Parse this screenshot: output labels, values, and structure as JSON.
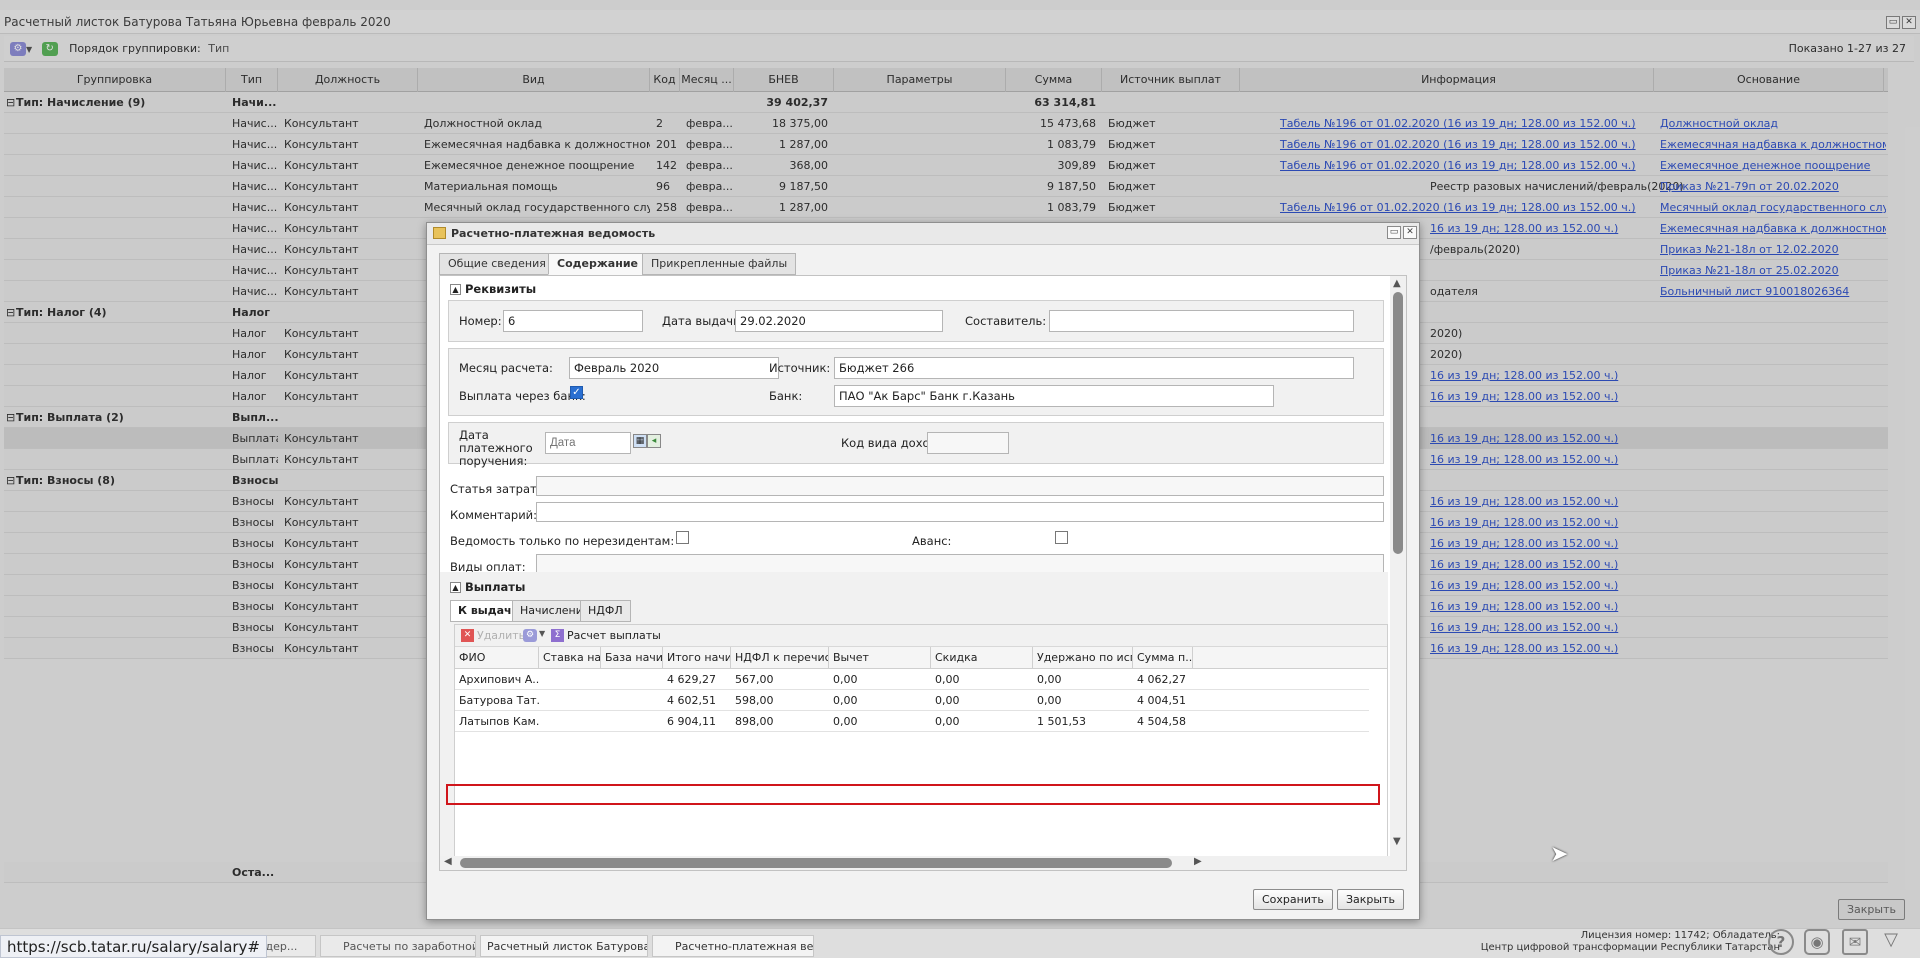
{
  "main": {
    "title": "Расчетный листок Батурова Татьяна Юрьевна февраль 2020",
    "toolbar": {
      "group_order_label": "Порядок группировки:",
      "group_order_value": "Тип",
      "shown": "Показано 1-27 из 27"
    },
    "columns": [
      "Группировка",
      "Тип",
      "Должность",
      "Вид",
      "Код",
      "Месяц ...",
      "БНЕВ",
      "Параметры",
      "Сумма",
      "Источник выплат",
      "Информация",
      "Основание"
    ],
    "rows": [
      {
        "group": "Тип: Начисление (9)",
        "type": "Начи...",
        "bnev": "39 402,37",
        "sum": "63 314,81"
      },
      {
        "type": "Начис...",
        "pos": "Консультант",
        "kind": "Должностной оклад",
        "code": "2",
        "month": "февра...",
        "bnev": "18 375,00",
        "sum": "15 473,68",
        "src": "Бюджет",
        "info": "Табель №196 от 01.02.2020 (16 из 19 дн; 128.00 из 152.00 ч.)",
        "basis": "Должностной оклад"
      },
      {
        "type": "Начис...",
        "pos": "Консультант",
        "kind": "Ежемесячная надбавка к должностному ...",
        "code": "201",
        "month": "февра...",
        "bnev": "1 287,00",
        "sum": "1 083,79",
        "src": "Бюджет",
        "info": "Табель №196 от 01.02.2020 (16 из 19 дн; 128.00 из 152.00 ч.)",
        "basis": "Ежемесячная надбавка к должностному о..."
      },
      {
        "type": "Начис...",
        "pos": "Консультант",
        "kind": "Ежемесячное денежное поощрение",
        "code": "142",
        "month": "февра...",
        "bnev": "368,00",
        "sum": "309,89",
        "src": "Бюджет",
        "info": "Табель №196 от 01.02.2020 (16 из 19 дн; 128.00 из 152.00 ч.)",
        "basis": "Ежемесячное денежное поощрение"
      },
      {
        "type": "Начис...",
        "pos": "Консультант",
        "kind": "Материальная помощь",
        "code": "96",
        "month": "февра...",
        "bnev": "9 187,50",
        "sum": "9 187,50",
        "src": "Бюджет",
        "info_plain": "Реестр разовых начислений/февраль(2020)",
        "basis": "Приказ №21-79п от 20.02.2020"
      },
      {
        "type": "Начис...",
        "pos": "Консультант",
        "kind": "Месячный оклад государственного служ...",
        "code": "258",
        "month": "февра...",
        "bnev": "1 287,00",
        "sum": "1 083,79",
        "src": "Бюджет",
        "info": "Табель №196 от 01.02.2020 (16 из 19 дн; 128.00 из 152.00 ч.)",
        "basis": "Месячный оклад государственного служа..."
      },
      {
        "type": "Начис...",
        "pos": "Консультант",
        "info": "16 из 19 дн; 128.00 из 152.00 ч.)",
        "basis": "Ежемесячная надбавка к должностному о..."
      },
      {
        "type": "Начис...",
        "pos": "Консультант",
        "info_plain": "/февраль(2020)",
        "basis": "Приказ №21-18л от 12.02.2020"
      },
      {
        "type": "Начис...",
        "pos": "Консультант",
        "basis": "Приказ №21-18л от 25.02.2020"
      },
      {
        "type": "Начис...",
        "pos": "Консультант",
        "info_plain": "одателя",
        "basis": "Больничный лист 910018026364"
      },
      {
        "group": "Тип: Налог (4)",
        "type": "Налог"
      },
      {
        "type": "Налог",
        "pos": "Консультант",
        "info_plain": "2020)"
      },
      {
        "type": "Налог",
        "pos": "Консультант",
        "info_plain": "2020)"
      },
      {
        "type": "Налог",
        "pos": "Консультант",
        "info": "16 из 19 дн; 128.00 из 152.00 ч.)"
      },
      {
        "type": "Налог",
        "pos": "Консультант",
        "info": "16 из 19 дн; 128.00 из 152.00 ч.)"
      },
      {
        "group": "Тип: Выплата (2)",
        "type": "Выпл..."
      },
      {
        "type": "Выплата",
        "pos": "Консультант",
        "info": "16 из 19 дн; 128.00 из 152.00 ч.)",
        "selected": "yes"
      },
      {
        "type": "Выплата",
        "pos": "Консультант",
        "info": "16 из 19 дн; 128.00 из 152.00 ч.)"
      },
      {
        "group": "Тип: Взносы (8)",
        "type": "Взносы"
      },
      {
        "type": "Взносы",
        "pos": "Консультант",
        "info": "16 из 19 дн; 128.00 из 152.00 ч.)"
      },
      {
        "type": "Взносы",
        "pos": "Консультант",
        "info": "16 из 19 дн; 128.00 из 152.00 ч.)"
      },
      {
        "type": "Взносы",
        "pos": "Консультант",
        "info": "16 из 19 дн; 128.00 из 152.00 ч.)"
      },
      {
        "type": "Взносы",
        "pos": "Консультант",
        "info": "16 из 19 дн; 128.00 из 152.00 ч.)"
      },
      {
        "type": "Взносы",
        "pos": "Консультант",
        "info": "16 из 19 дн; 128.00 из 152.00 ч.)"
      },
      {
        "type": "Взносы",
        "pos": "Консультант",
        "info": "16 из 19 дн; 128.00 из 152.00 ч.)"
      },
      {
        "type": "Взносы",
        "pos": "Консультант",
        "info": "16 из 19 дн; 128.00 из 152.00 ч.)"
      },
      {
        "type": "Взносы",
        "pos": "Консультант",
        "info": "16 из 19 дн; 128.00 из 152.00 ч.)"
      }
    ],
    "footer_row_type": "Оста...",
    "close_label": "Закрыть"
  },
  "dialog": {
    "title": "Расчетно-платежная ведомость",
    "tabs": [
      "Общие сведения",
      "Содержание",
      "Прикрепленные файлы"
    ],
    "requisites": {
      "header": "Реквизиты",
      "number_label": "Номер:",
      "number": "6",
      "issue_date_label": "Дата выдачи:",
      "issue_date": "29.02.2020",
      "author_label": "Составитель:",
      "author": "",
      "month_label": "Месяц расчета:",
      "month": "Февраль 2020",
      "source_label": "Источник:",
      "source": "Бюджет 266",
      "bank_pay_label": "Выплата через банк:",
      "bank_label": "Банк:",
      "bank": "ПАО \"Ак Барс\" Банк г.Казань",
      "pay_order_date_label": "Дата платежного поручения:",
      "pay_order_date_placeholder": "Дата",
      "income_code_label": "Код вида дохода:",
      "cost_item_label": "Статья затрат:",
      "comment_label": "Комментарий:",
      "nonres_label": "Ведомость только по нерезидентам:",
      "advance_label": "Аванс:",
      "pay_types_label": "Виды оплат:"
    },
    "payments": {
      "header": "Выплаты",
      "tabs": [
        "К выдаче",
        "Начисление",
        "НДФЛ"
      ],
      "delete_label": "Удалить",
      "calc_label": "Расчет выплаты",
      "columns": [
        "ФИО",
        "Ставка нал...",
        "База начис...",
        "Итого начис...",
        "НДФЛ к перечислен...",
        "Вычет",
        "Скидка",
        "Удержано по испол...",
        "Сумма п..."
      ],
      "rows": [
        [
          "Архипович А...",
          "",
          "",
          "4 629,27",
          "567,00",
          "0,00",
          "0,00",
          "0,00",
          "4 062,27"
        ],
        [
          "Батурова Тат...",
          "",
          "",
          "4 602,51",
          "598,00",
          "0,00",
          "0,00",
          "0,00",
          "4 004,51"
        ],
        [
          "Латыпов Кам...",
          "",
          "",
          "6 904,11",
          "898,00",
          "0,00",
          "0,00",
          "1 501,53",
          "4 504,58"
        ]
      ]
    },
    "save_label": "Сохранить",
    "close_label": "Закрыть"
  },
  "taskbar": {
    "items": [
      "...дер...",
      "Расчеты по заработной ...",
      "Расчетный листок Батурова ...",
      "Расчетно-платежная вед..."
    ],
    "url": "https://scb.tatar.ru/salary/salary#",
    "license_line1": "Лицензия номер: 11742; Обладатель:",
    "license_line2": "Центр цифровой трансформации Республики Татарстан"
  },
  "colors": {
    "link": "#3355cc",
    "highlight": "#d0151b",
    "checkbox": "#2a6fd1"
  }
}
